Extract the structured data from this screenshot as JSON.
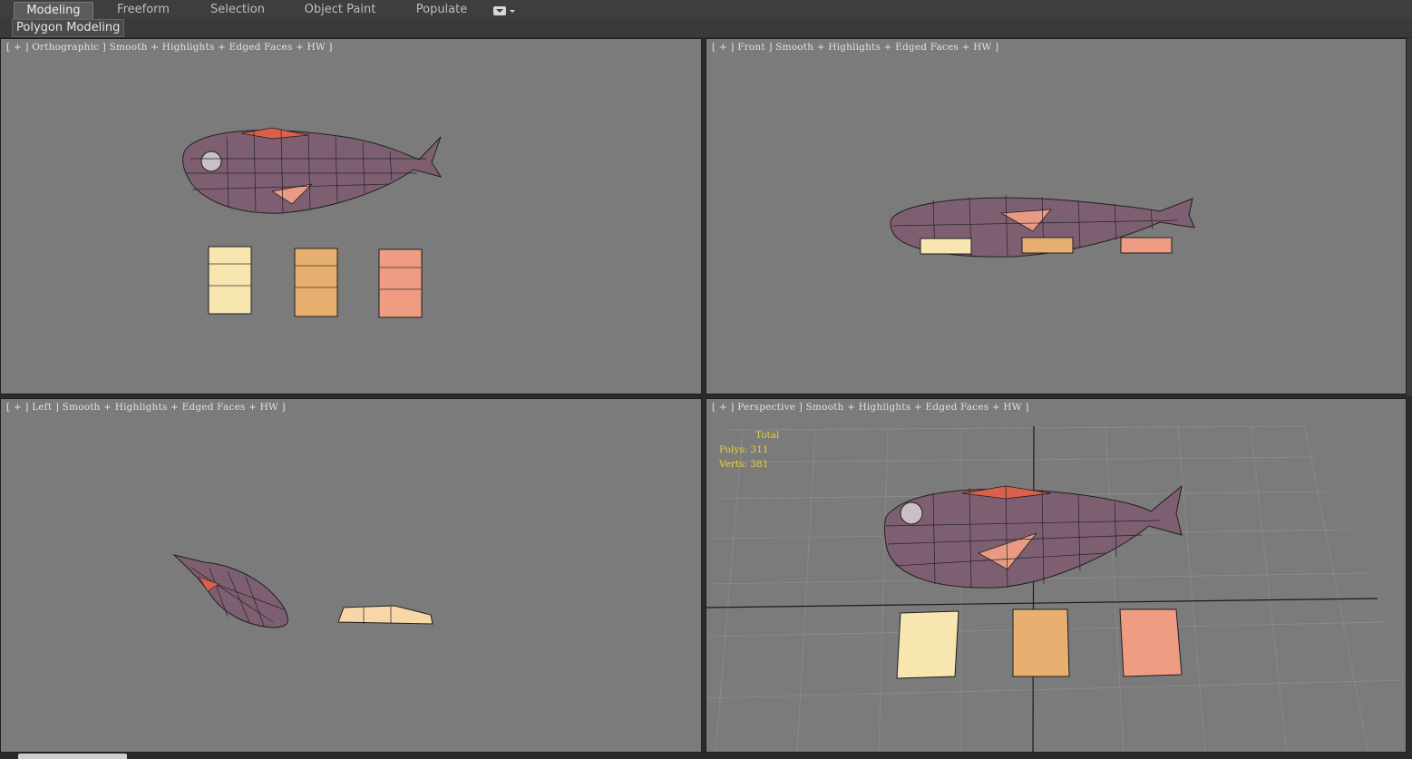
{
  "ribbon": {
    "tabs": [
      {
        "label": "Modeling",
        "active": true
      },
      {
        "label": "Freeform",
        "active": false
      },
      {
        "label": "Selection",
        "active": false
      },
      {
        "label": "Object Paint",
        "active": false
      },
      {
        "label": "Populate",
        "active": false
      }
    ],
    "dropdown_icon": "chevron-down-icon",
    "panel_label": "Polygon Modeling"
  },
  "viewports": {
    "top_left": {
      "label": "[ + ] Orthographic ] Smooth + Highlights + Edged Faces + HW ]"
    },
    "top_right": {
      "label": "[ + ] Front ] Smooth + Highlights + Edged Faces + HW ]"
    },
    "bottom_left": {
      "label": "[ + ] Left ] Smooth + Highlights + Edged Faces + HW ]"
    },
    "bottom_right": {
      "label": "[ + ] Perspective ] Smooth + Highlights + Edged Faces + HW ]"
    }
  },
  "stats": {
    "header": "Total",
    "polys_label": "Polys:",
    "polys_value": "311",
    "verts_label": "Verts:",
    "verts_value": "381"
  },
  "colors": {
    "viewport_bg": "#7b7b7b",
    "stats_text": "#e8d23a",
    "fish_body": "#7b5a6e",
    "fish_fin": "#d9604a"
  }
}
